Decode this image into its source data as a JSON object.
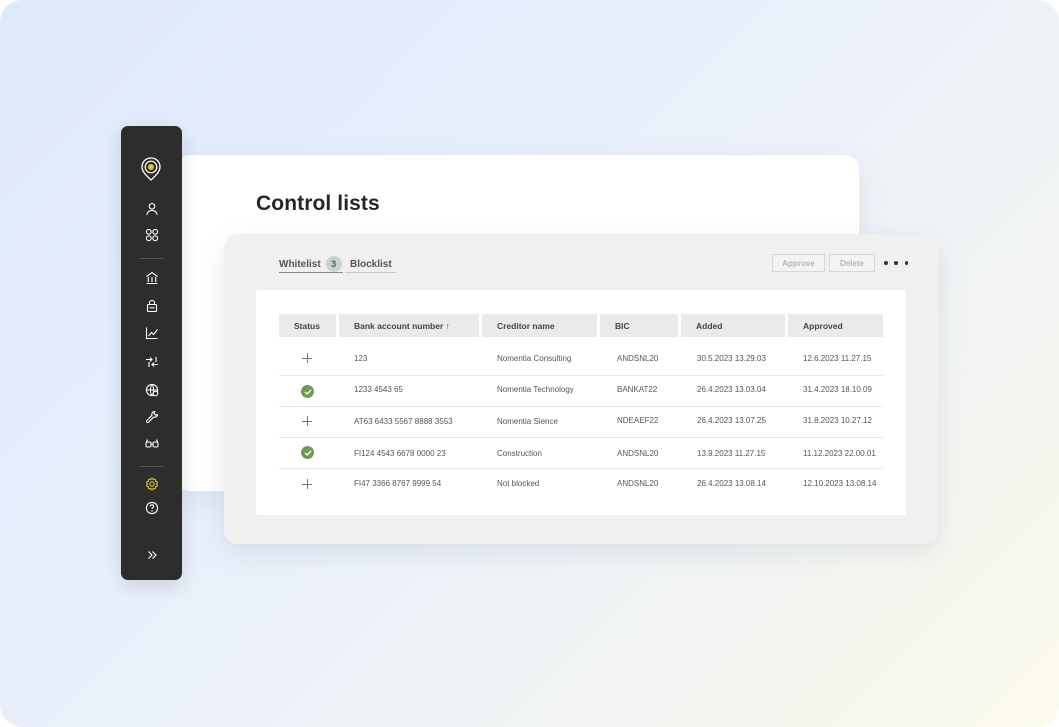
{
  "page": {
    "title": "Control lists"
  },
  "tabs": [
    {
      "label": "Whitelist",
      "count": "3",
      "active": true
    },
    {
      "label": "Blocklist",
      "active": false
    }
  ],
  "actions": {
    "approve_label": "Approve",
    "delete_label": "Delete"
  },
  "table": {
    "columns": [
      "Status",
      "Bank account number ↑",
      "Creditor name",
      "BIC",
      "Added",
      "Approved"
    ],
    "rows": [
      {
        "status": "pending",
        "account": "123",
        "creditor": "Nomentia Consulting",
        "bic": "ANDSNL20",
        "added": "30.5.2023 13.29.03",
        "approved": "12.6.2023 11.27.15"
      },
      {
        "status": "approved",
        "account": "1233 4543 65",
        "creditor": "Nomentia Technology",
        "bic": "BANKAT22",
        "added": "26.4.2023 13.03.04",
        "approved": "31.4.2023 18.10.09"
      },
      {
        "status": "pending",
        "account": "AT63 6433 5567 8888 3553",
        "creditor": "Nomentia Sience",
        "bic": "NDEAEF22",
        "added": "26.4.2023 13.07.25",
        "approved": "31.8.2023 10.27.12"
      },
      {
        "status": "approved",
        "account": "FI124 4543 6678 0000 23",
        "creditor": "Construction",
        "bic": "ANDSNL20",
        "added": "13.9.2023 11.27.15",
        "approved": "11.12.2023 22.00.01"
      },
      {
        "status": "pending",
        "account": "FI47 3366 8767 9999 54",
        "creditor": "Not blocked",
        "bic": "ANDSNL20",
        "added": "26.4.2023 13.08.14",
        "approved": "12.10.2023 13.08.14"
      }
    ]
  },
  "sidebar": {
    "icons": [
      "user-icon",
      "apps-icon",
      "bank-icon",
      "lock-icon",
      "chart-icon",
      "transfer-icon",
      "globe-icon",
      "wrench-icon",
      "glasses-icon",
      "settings-icon",
      "help-icon",
      "expand-icon"
    ]
  },
  "colors": {
    "sidebar_bg": "#2c2e2b",
    "accent_yellow": "#e3c229",
    "approved_green": "#6f9a57",
    "badge_bg": "#c9d3cb"
  }
}
